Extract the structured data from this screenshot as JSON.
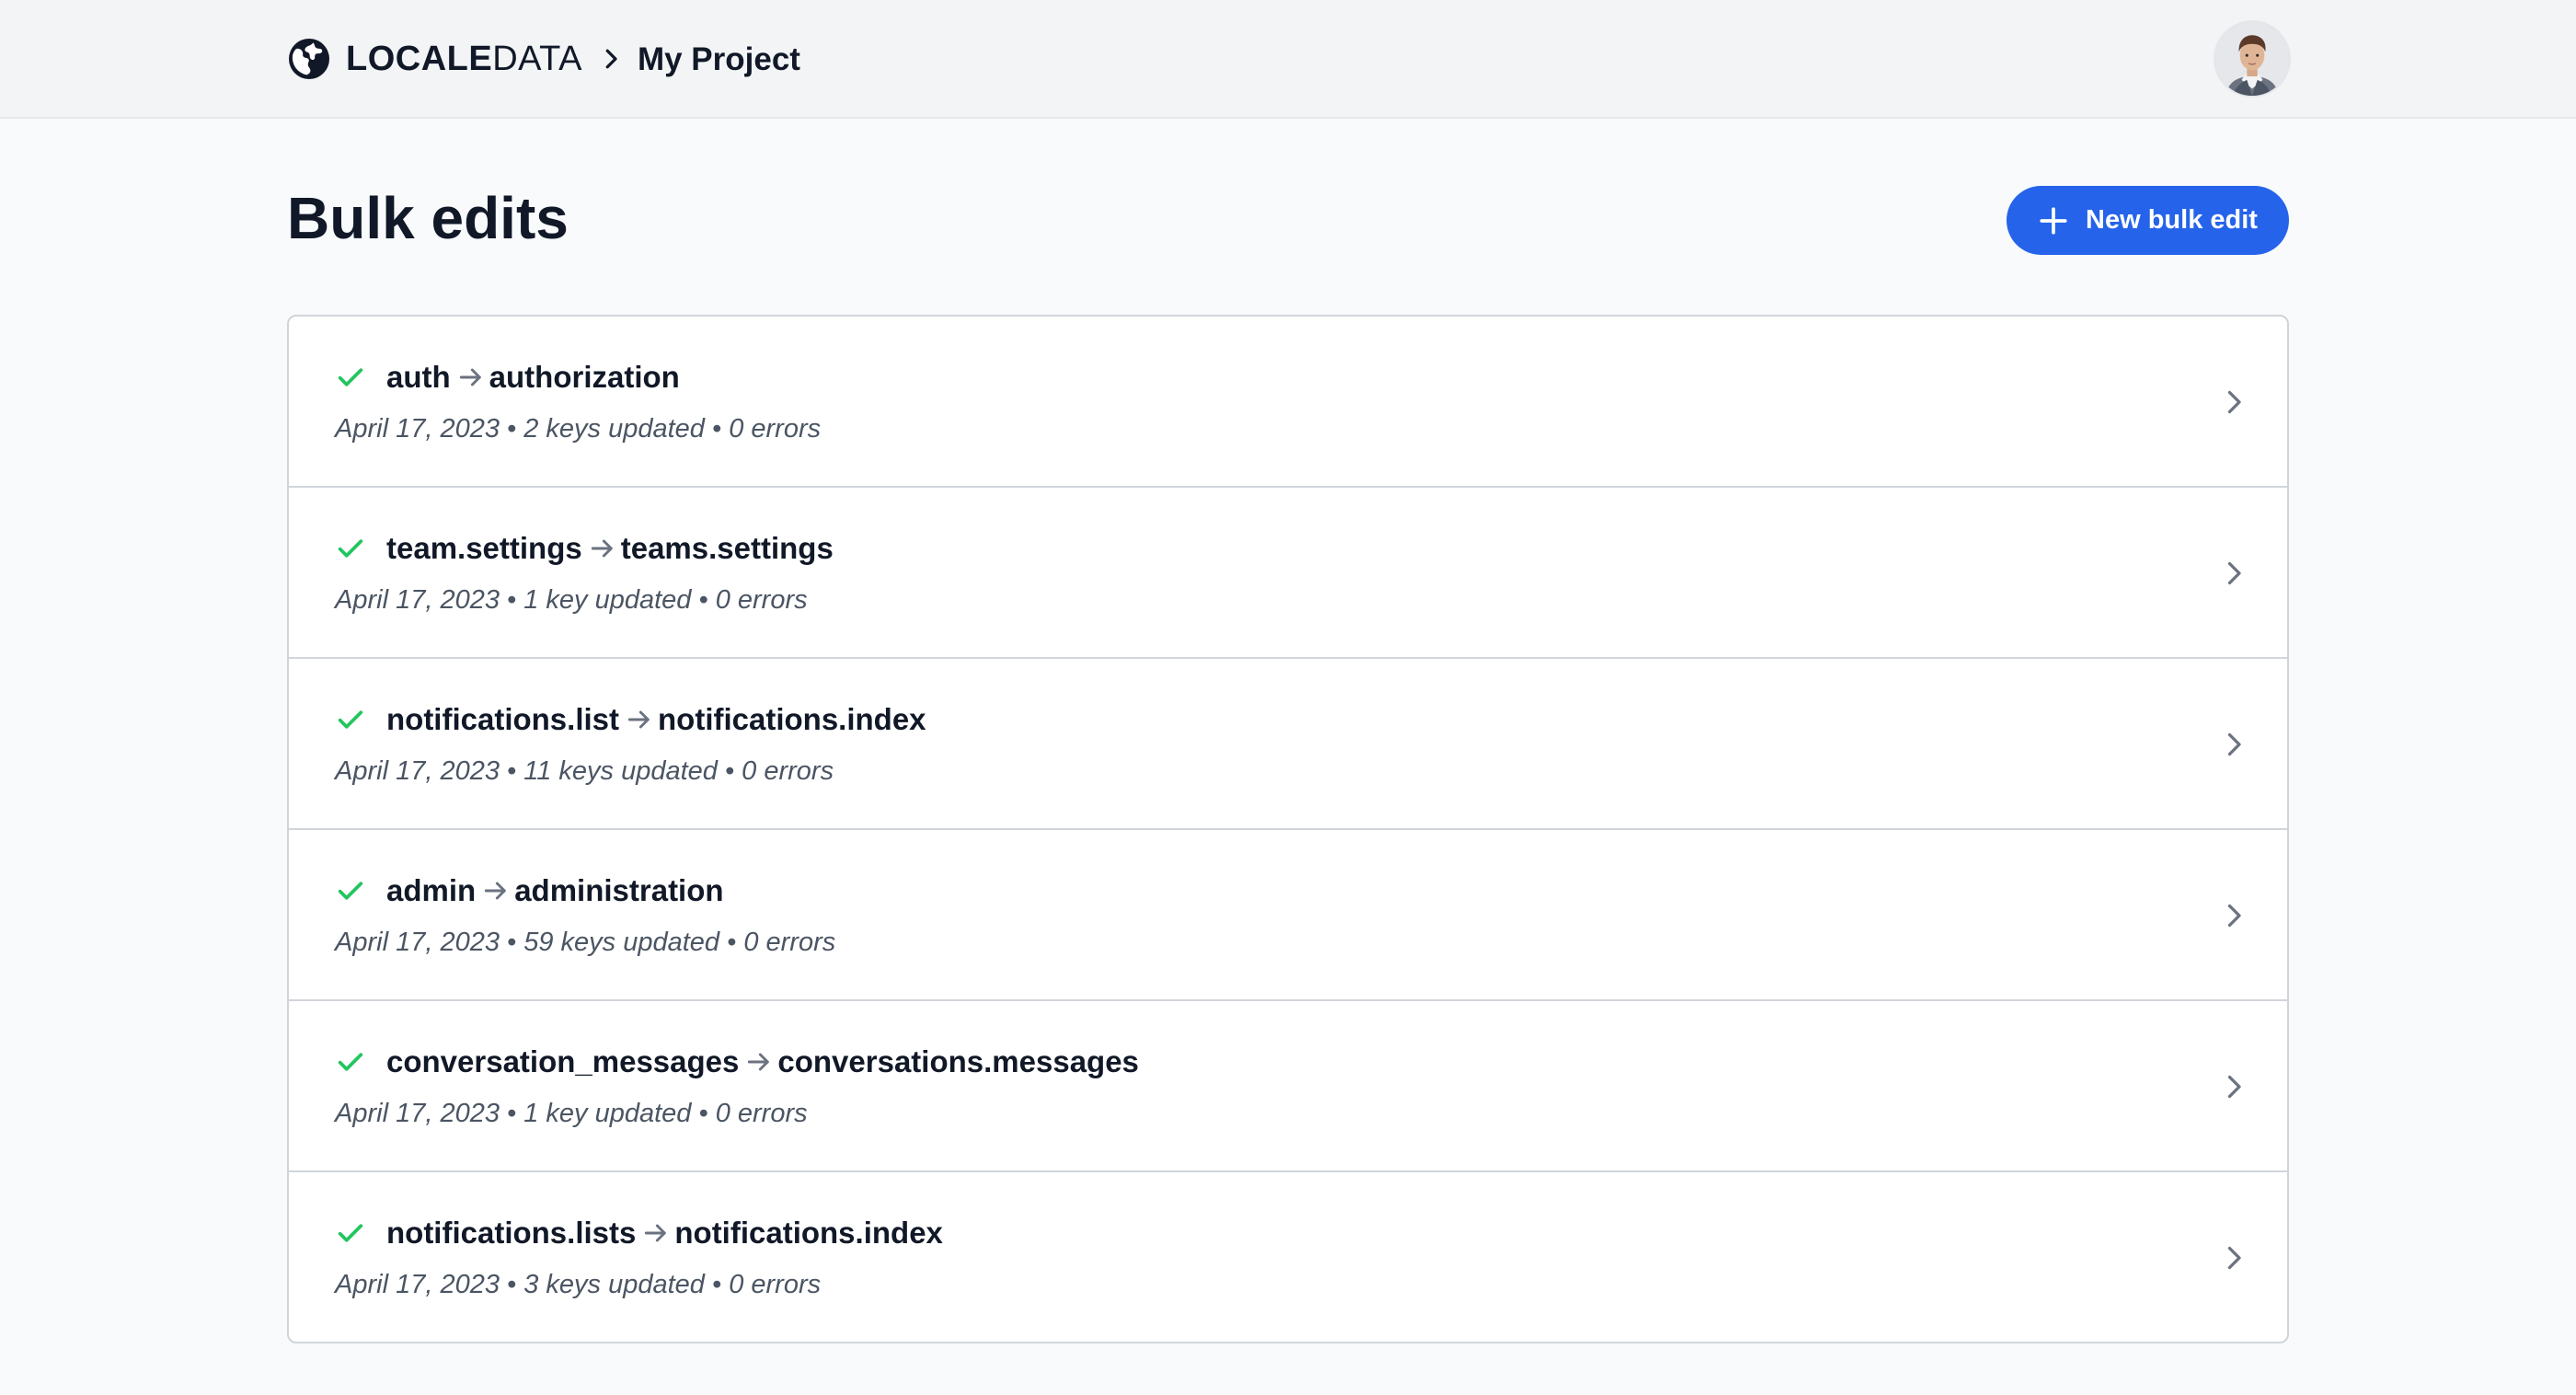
{
  "header": {
    "logo_bold": "LOCALE",
    "logo_light": "DATA",
    "breadcrumb_project": "My Project"
  },
  "page": {
    "title": "Bulk edits",
    "new_button_label": "New bulk edit"
  },
  "colors": {
    "accent": "#2563eb",
    "success": "#22c55e"
  },
  "bulk_edits": [
    {
      "from": "auth",
      "to": "authorization",
      "meta": "April 17, 2023 • 2 keys updated • 0 errors"
    },
    {
      "from": "team.settings",
      "to": "teams.settings",
      "meta": "April 17, 2023 • 1 key updated • 0 errors"
    },
    {
      "from": "notifications.list",
      "to": "notifications.index",
      "meta": "April 17, 2023 • 11 keys updated • 0 errors"
    },
    {
      "from": "admin",
      "to": "administration",
      "meta": "April 17, 2023 • 59 keys updated • 0 errors"
    },
    {
      "from": "conversation_messages",
      "to": "conversations.messages",
      "meta": "April 17, 2023 • 1 key updated • 0 errors"
    },
    {
      "from": "notifications.lists",
      "to": "notifications.index",
      "meta": "April 17, 2023 • 3 keys updated • 0 errors"
    }
  ]
}
